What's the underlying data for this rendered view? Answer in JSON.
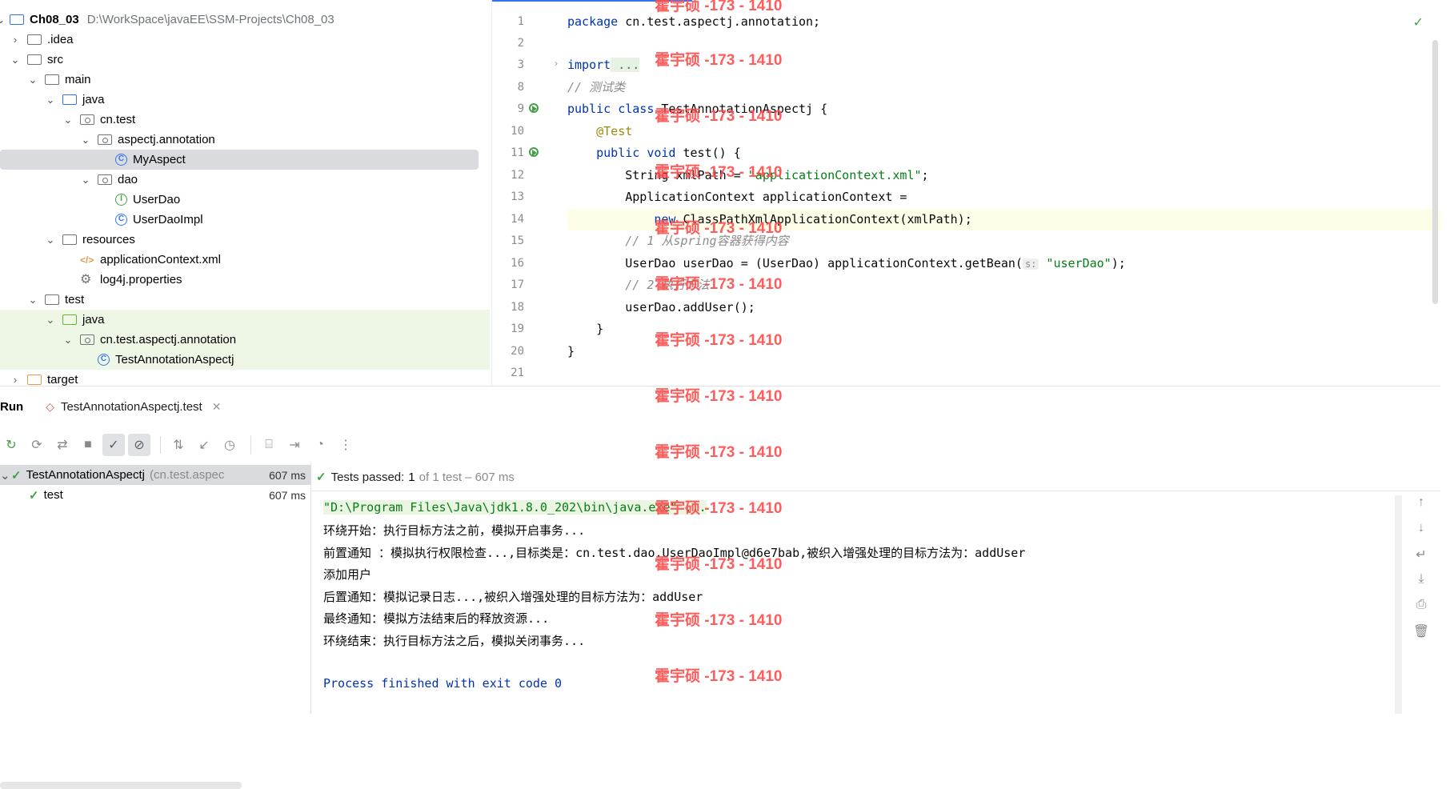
{
  "project": {
    "root_name": "Ch08_03",
    "root_path": "D:\\WorkSpace\\javaEE\\SSM-Projects\\Ch08_03",
    "items": [
      {
        "label": ".idea",
        "depth": 1,
        "chevron": "›",
        "icon": "folder"
      },
      {
        "label": "src",
        "depth": 1,
        "chevron": "⌄",
        "icon": "folder"
      },
      {
        "label": "main",
        "depth": 2,
        "chevron": "⌄",
        "icon": "folder"
      },
      {
        "label": "java",
        "depth": 3,
        "chevron": "⌄",
        "icon": "folder-blue"
      },
      {
        "label": "cn.test",
        "depth": 4,
        "chevron": "⌄",
        "icon": "package"
      },
      {
        "label": "aspectj.annotation",
        "depth": 5,
        "chevron": "⌄",
        "icon": "package"
      },
      {
        "label": "MyAspect",
        "depth": 6,
        "chevron": "",
        "icon": "class"
      },
      {
        "label": "dao",
        "depth": 5,
        "chevron": "⌄",
        "icon": "package"
      },
      {
        "label": "UserDao",
        "depth": 6,
        "chevron": "",
        "icon": "interface"
      },
      {
        "label": "UserDaoImpl",
        "depth": 6,
        "chevron": "",
        "icon": "class"
      },
      {
        "label": "resources",
        "depth": 3,
        "chevron": "⌄",
        "icon": "folder-res"
      },
      {
        "label": "applicationContext.xml",
        "depth": 4,
        "chevron": "",
        "icon": "xml"
      },
      {
        "label": "log4j.properties",
        "depth": 4,
        "chevron": "",
        "icon": "gear"
      },
      {
        "label": "test",
        "depth": 2,
        "chevron": "⌄",
        "icon": "folder"
      },
      {
        "label": "java",
        "depth": 3,
        "chevron": "⌄",
        "icon": "folder-green"
      },
      {
        "label": "cn.test.aspectj.annotation",
        "depth": 4,
        "chevron": "⌄",
        "icon": "package"
      },
      {
        "label": "TestAnnotationAspectj",
        "depth": 5,
        "chevron": "",
        "icon": "class"
      },
      {
        "label": "target",
        "depth": 1,
        "chevron": "›",
        "icon": "folder-orange"
      }
    ]
  },
  "editor": {
    "line_numbers": [
      "1",
      "2",
      "3",
      "8",
      "9",
      "10",
      "11",
      "12",
      "13",
      "14",
      "15",
      "16",
      "17",
      "18",
      "19",
      "20",
      "21"
    ],
    "code": {
      "l1_kw": "package",
      "l1_rest": " cn.test.aspectj.annotation;",
      "l3_kw": "import",
      "l3_fold": " ...",
      "l8": "// 测试类",
      "l9_kw": "public class",
      "l9_rest": " TestAnnotationAspectj {",
      "l10": "    @Test",
      "l11_kw": "    public void",
      "l11_rest": " test() {",
      "l12_a": "        String xmlPath = ",
      "l12_str": "\"applicationContext.xml\"",
      "l12_b": ";",
      "l13": "        ApplicationContext applicationContext =",
      "l14_kw": "            new",
      "l14_rest": " ClassPathXmlApplicationContext(xmlPath);",
      "l15": "        // 1 从spring容器获得内容",
      "l16_a": "        UserDao userDao = (UserDao) applicationContext.getBean(",
      "l16_hint": "s:",
      "l16_str": " \"userDao\"",
      "l16_b": ");",
      "l17": "        // 2 执行方法",
      "l18": "        userDao.addUser();",
      "l19": "    }",
      "l20": "}"
    }
  },
  "watermark": "霍宇硕 -173 - 1410",
  "run": {
    "title": "Run",
    "tab_label": "TestAnnotationAspectj.test",
    "results": {
      "suite_name": "TestAnnotationAspectj",
      "suite_pkg": "(cn.test.aspec",
      "suite_time": "607 ms",
      "test_name": "test",
      "test_time": "607 ms"
    },
    "status": {
      "passed_label": "Tests passed:",
      "passed_count": "1",
      "total": "of 1 test – 607 ms"
    },
    "console": [
      "\"D:\\Program Files\\Java\\jdk1.8.0_202\\bin\\java.exe\" ...",
      "环绕开始：执行目标方法之前，模拟开启事务...",
      "前置通知 ：模拟执行权限检查...,目标类是：cn.test.dao.UserDaoImpl@d6e7bab,被织入增强处理的目标方法为：addUser",
      "添加用户",
      "后置通知：模拟记录日志...,被织入增强处理的目标方法为：addUser",
      "最终通知：模拟方法结束后的释放资源...",
      "环绕结束：执行目标方法之后，模拟关闭事务...",
      "",
      "Process finished with exit code 0"
    ]
  }
}
